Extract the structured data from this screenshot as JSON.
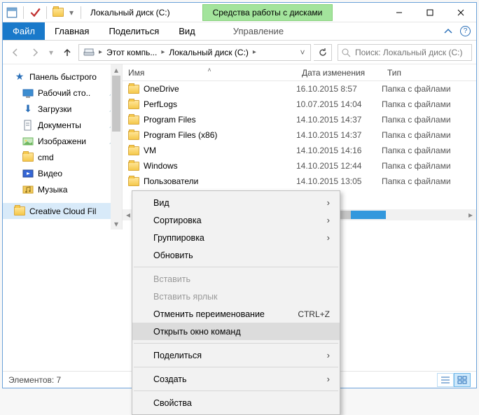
{
  "titlebar": {
    "title": "Локальный диск (C:)",
    "context_tab": "Средства работы с дисками"
  },
  "tabs": {
    "file": "Файл",
    "home": "Главная",
    "share": "Поделиться",
    "view": "Вид",
    "manage": "Управление"
  },
  "nav": {
    "back_enabled": false,
    "forward_enabled": false,
    "up_enabled": true
  },
  "address": {
    "level1": "Этот компь...",
    "level2": "Локальный диск (C:)"
  },
  "search": {
    "placeholder": "Поиск: Локальный диск (C:)"
  },
  "navpane": {
    "quick": "Панель быстрого",
    "items": [
      {
        "label": "Рабочий сто..",
        "pin": true,
        "icon": "desktop"
      },
      {
        "label": "Загрузки",
        "pin": true,
        "icon": "download"
      },
      {
        "label": "Документы",
        "pin": true,
        "icon": "document"
      },
      {
        "label": "Изображени",
        "pin": true,
        "icon": "picture"
      },
      {
        "label": "cmd",
        "pin": false,
        "icon": "folder"
      },
      {
        "label": "Видео",
        "pin": false,
        "icon": "video"
      },
      {
        "label": "Музыка",
        "pin": false,
        "icon": "music"
      }
    ],
    "creative_cloud": "Creative Cloud Fil"
  },
  "columns": {
    "name": "Имя",
    "date": "Дата изменения",
    "type": "Тип"
  },
  "rows": [
    {
      "name": "OneDrive",
      "date": "16.10.2015 8:57",
      "type": "Папка с файлами"
    },
    {
      "name": "PerfLogs",
      "date": "10.07.2015 14:04",
      "type": "Папка с файлами"
    },
    {
      "name": "Program Files",
      "date": "14.10.2015 14:37",
      "type": "Папка с файлами"
    },
    {
      "name": "Program Files (x86)",
      "date": "14.10.2015 14:37",
      "type": "Папка с файлами"
    },
    {
      "name": "VM",
      "date": "14.10.2015 14:16",
      "type": "Папка с файлами"
    },
    {
      "name": "Windows",
      "date": "14.10.2015 12:44",
      "type": "Папка с файлами"
    },
    {
      "name": "Пользователи",
      "date": "14.10.2015 13:05",
      "type": "Папка с файлами"
    }
  ],
  "status": {
    "count_label": "Элементов: 7"
  },
  "context_menu": {
    "view": "Вид",
    "sort": "Сортировка",
    "group": "Группировка",
    "refresh": "Обновить",
    "paste": "Вставить",
    "paste_shortcut": "Вставить ярлык",
    "undo_rename": "Отменить переименование",
    "undo_short": "CTRL+Z",
    "open_cmd": "Открыть окно команд",
    "share": "Поделиться",
    "new": "Создать",
    "properties": "Свойства"
  }
}
